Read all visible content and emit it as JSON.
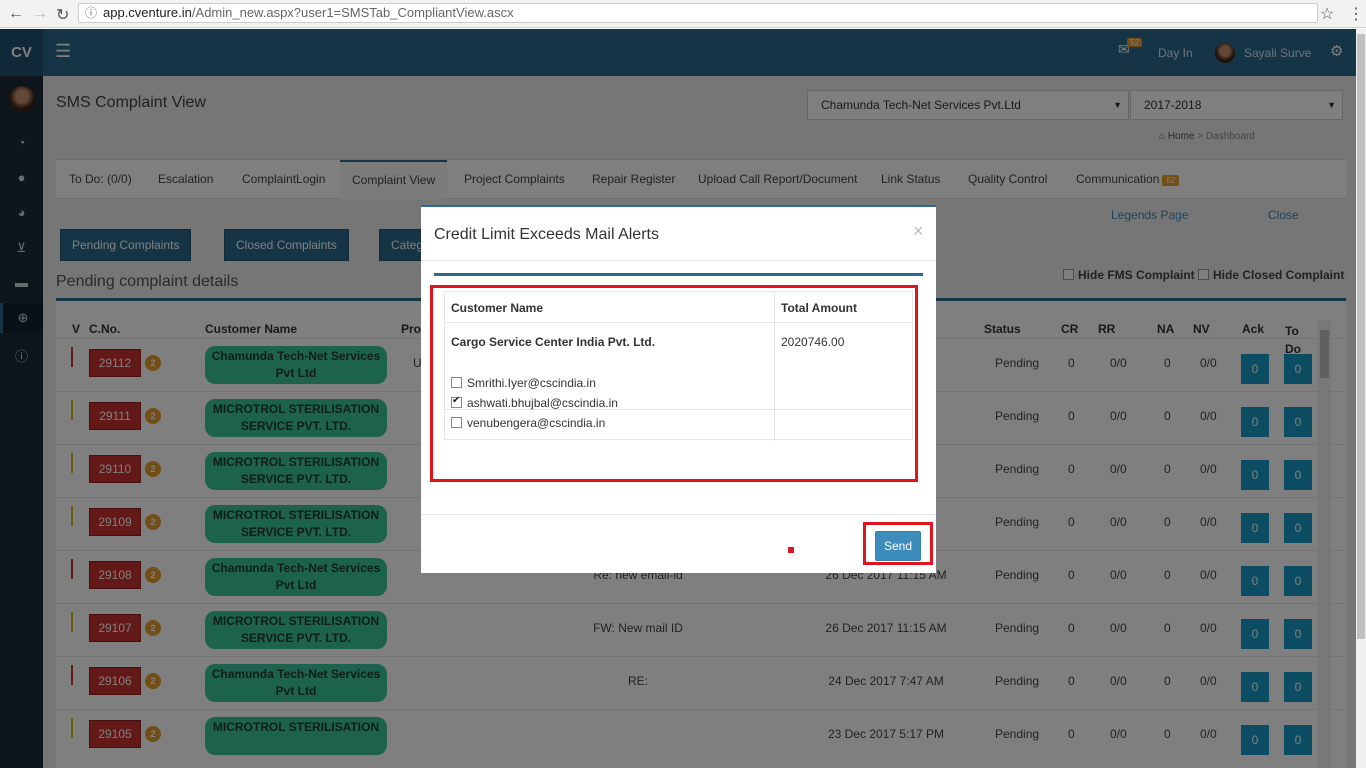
{
  "browser": {
    "url_host": "app.cventure.in",
    "url_path": "/Admin_new.aspx?user1=SMSTab_CompliantView.ascx"
  },
  "topbar": {
    "brand": "CV",
    "notif_count": "52",
    "day_in_label": "Day In",
    "user_name": "Sayali Surve"
  },
  "sidebar": {
    "icons": [
      "dashboard-icon",
      "user-icon",
      "pie-chart-icon",
      "cart-icon",
      "credit-card-icon",
      "life-ring-icon",
      "info-icon"
    ]
  },
  "page": {
    "title": "SMS Complaint View",
    "company_select": "Chamunda Tech-Net Services Pvt.Ltd",
    "year_select": "2017-2018",
    "breadcrumb_home": "Home",
    "breadcrumb_sep": ">",
    "breadcrumb_current": "Dashboard"
  },
  "tabs": [
    {
      "label": "To Do: (0/0)"
    },
    {
      "label": "Escalation"
    },
    {
      "label": "ComplaintLogin"
    },
    {
      "label": "Complaint View"
    },
    {
      "label": "Project Complaints"
    },
    {
      "label": "Repair Register"
    },
    {
      "label": "Upload Call Report/Document"
    },
    {
      "label": "Link Status"
    },
    {
      "label": "Quality Control"
    },
    {
      "label": "Communication",
      "badge": "52"
    }
  ],
  "links": {
    "legends": "Legends Page",
    "close": "Close"
  },
  "buttons": {
    "pending": "Pending Complaints",
    "closed": "Closed Complaints",
    "category": "Categ"
  },
  "section": {
    "title": "Pending complaint details",
    "hide_fms": "Hide FMS Complaint",
    "hide_closed": "Hide Closed Complaint"
  },
  "table": {
    "headers": [
      "V",
      "C.No.",
      "Customer Name",
      "Pro",
      "Status",
      "CR",
      "RR",
      "NA",
      "NV",
      "Ack",
      "To Do"
    ],
    "rows": [
      {
        "cno": "29112",
        "count": "2",
        "customer": "Chamunda Tech-Net Services Pvt Ltd",
        "col4": "U",
        "subject": "",
        "date": "",
        "status": "Pending",
        "cr": "0",
        "rr": "0/0",
        "na": "0",
        "nv": "0/0",
        "ack": "0",
        "todo": "0",
        "bar": "#c7322e"
      },
      {
        "cno": "29111",
        "count": "2",
        "customer": "MICROTROL STERILISATION SERVICE PVT. LTD.",
        "col4": "",
        "subject": "",
        "date": "",
        "status": "Pending",
        "cr": "0",
        "rr": "0/0",
        "na": "0",
        "nv": "0/0",
        "ack": "0",
        "todo": "0",
        "bar": "#d4b21c"
      },
      {
        "cno": "29110",
        "count": "2",
        "customer": "MICROTROL STERILISATION SERVICE PVT. LTD.",
        "col4": "",
        "subject": "",
        "date": "",
        "status": "Pending",
        "cr": "0",
        "rr": "0/0",
        "na": "0",
        "nv": "0/0",
        "ack": "0",
        "todo": "0",
        "bar": "#d4b21c"
      },
      {
        "cno": "29109",
        "count": "2",
        "customer": "MICROTROL STERILISATION SERVICE PVT. LTD.",
        "col4": "",
        "subject": "",
        "date": "",
        "status": "Pending",
        "cr": "0",
        "rr": "0/0",
        "na": "0",
        "nv": "0/0",
        "ack": "0",
        "todo": "0",
        "bar": "#d4b21c"
      },
      {
        "cno": "29108",
        "count": "2",
        "customer": "Chamunda Tech-Net Services Pvt Ltd",
        "col4": "",
        "subject": "Re: new email-id",
        "date": "26 Dec 2017 11:15 AM",
        "status": "Pending",
        "cr": "0",
        "rr": "0/0",
        "na": "0",
        "nv": "0/0",
        "ack": "0",
        "todo": "0",
        "bar": "#c7322e"
      },
      {
        "cno": "29107",
        "count": "2",
        "customer": "MICROTROL STERILISATION SERVICE PVT. LTD.",
        "col4": "",
        "subject": "FW: New mail ID",
        "date": "26 Dec 2017 11:15 AM",
        "status": "Pending",
        "cr": "0",
        "rr": "0/0",
        "na": "0",
        "nv": "0/0",
        "ack": "0",
        "todo": "0",
        "bar": "#d4b21c"
      },
      {
        "cno": "29106",
        "count": "2",
        "customer": "Chamunda Tech-Net Services Pvt Ltd",
        "col4": "",
        "subject": "RE:",
        "date": "24 Dec 2017 7:47 AM",
        "status": "Pending",
        "cr": "0",
        "rr": "0/0",
        "na": "0",
        "nv": "0/0",
        "ack": "0",
        "todo": "0",
        "bar": "#c7322e"
      },
      {
        "cno": "29105",
        "count": "2",
        "customer": "MICROTROL STERILISATION",
        "col4": "",
        "subject": "",
        "date": "23 Dec 2017 5:17 PM",
        "status": "Pending",
        "cr": "0",
        "rr": "0/0",
        "na": "0",
        "nv": "0/0",
        "ack": "0",
        "todo": "0",
        "bar": "#d4b21c"
      }
    ]
  },
  "modal": {
    "title": "Credit Limit Exceeds Mail Alerts",
    "close_glyph": "×",
    "col_customer": "Customer Name",
    "col_amount": "Total Amount",
    "customer": "Cargo Service Center India Pvt. Ltd.",
    "amount": "2020746.00",
    "emails": [
      {
        "address": "Smrithi.Iyer@cscindia.in",
        "checked": false
      },
      {
        "address": "ashwati.bhujbal@cscindia.in",
        "checked": true
      },
      {
        "address": "venubengera@cscindia.in",
        "checked": false
      }
    ],
    "send_label": "Send",
    "highlight_color": "#e0141e"
  }
}
